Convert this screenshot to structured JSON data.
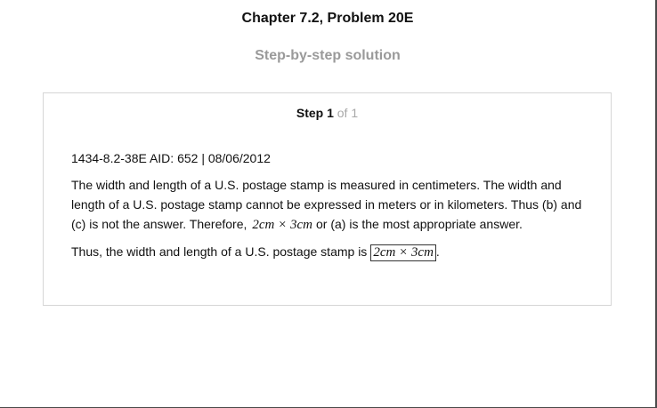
{
  "header": {
    "chapter_title": "Chapter 7.2, Problem 20E",
    "subtitle": "Step-by-step solution"
  },
  "step": {
    "label": "Step 1",
    "of_label": "of 1",
    "meta_line": "1434-8.2-38E AID: 652 | 08/06/2012",
    "paragraph1_before_math": "The width and length of a U.S. postage stamp is measured in centimeters. The width and length of a U.S. postage stamp cannot be expressed in meters or in kilometers. Thus (b) and (c) is not the answer. Therefore,",
    "inline_math": "2cm × 3cm",
    "paragraph1_after_math": "or (a) is the most appropriate answer.",
    "paragraph2_before_math": "Thus, the width and length of a U.S. postage stamp is",
    "boxed_math": "2cm × 3cm",
    "paragraph2_after_math": "."
  }
}
